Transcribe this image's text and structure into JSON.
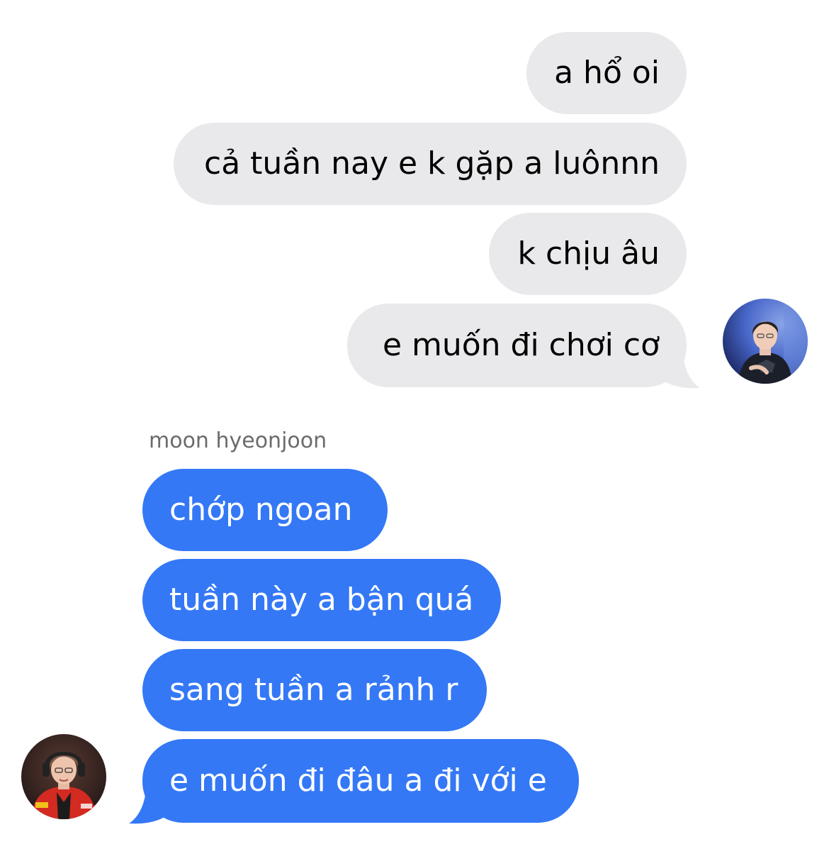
{
  "outgoing": [
    {
      "text": "a hổ oi"
    },
    {
      "text": "cả tuần nay e k gặp a luônnn"
    },
    {
      "text": "k chịu âu"
    },
    {
      "text": "e muốn đi chơi cơ"
    }
  ],
  "incoming_sender": "moon hyeonjoon",
  "incoming": [
    {
      "text": "chớp ngoan"
    },
    {
      "text": "tuần này a bận quá"
    },
    {
      "text": "sang tuần a rảnh r"
    },
    {
      "text": "e muốn đi đâu a đi với e"
    }
  ],
  "colors": {
    "outgoing_bubble": "#e9e9eb",
    "incoming_bubble": "#3478f6",
    "incoming_text": "#ffffff",
    "sender_label": "#6b6b6b"
  },
  "icons": {
    "self_avatar": "user-photo-avatar",
    "contact_avatar": "contact-photo-avatar"
  }
}
